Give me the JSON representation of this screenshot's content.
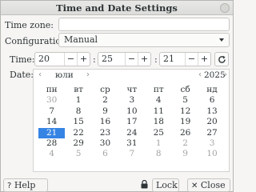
{
  "window": {
    "title": "Time and Date Settings"
  },
  "timezone": {
    "label": "Time zone:",
    "value": ""
  },
  "configuration": {
    "label": "Configuration:",
    "value": "Manual"
  },
  "time": {
    "label": "Time:",
    "hours": "20",
    "minutes": "25",
    "seconds": "21",
    "separator": ":",
    "minus": "−",
    "plus": "+"
  },
  "date": {
    "label": "Date:",
    "month": "юли",
    "year": "2025",
    "weekdays": [
      "пн",
      "вт",
      "ср",
      "чт",
      "пт",
      "сб",
      "нд"
    ],
    "weeks": [
      [
        "30",
        "1",
        "2",
        "3",
        "4",
        "5",
        "6"
      ],
      [
        "7",
        "8",
        "9",
        "10",
        "11",
        "12",
        "13"
      ],
      [
        "14",
        "15",
        "16",
        "17",
        "18",
        "19",
        "20"
      ],
      [
        "21",
        "22",
        "23",
        "24",
        "25",
        "26",
        "27"
      ],
      [
        "28",
        "29",
        "30",
        "31",
        "1",
        "2",
        "3"
      ],
      [
        "4",
        "5",
        "6",
        "7",
        "8",
        "9",
        "10"
      ]
    ],
    "selected_day": "21",
    "nav": {
      "prev": "‹",
      "next": "›"
    }
  },
  "buttons": {
    "help": "Help",
    "lock": "Lock",
    "close": "Close"
  },
  "colors": {
    "accent": "#3584e4",
    "dim_text": "#a2a4a1"
  }
}
